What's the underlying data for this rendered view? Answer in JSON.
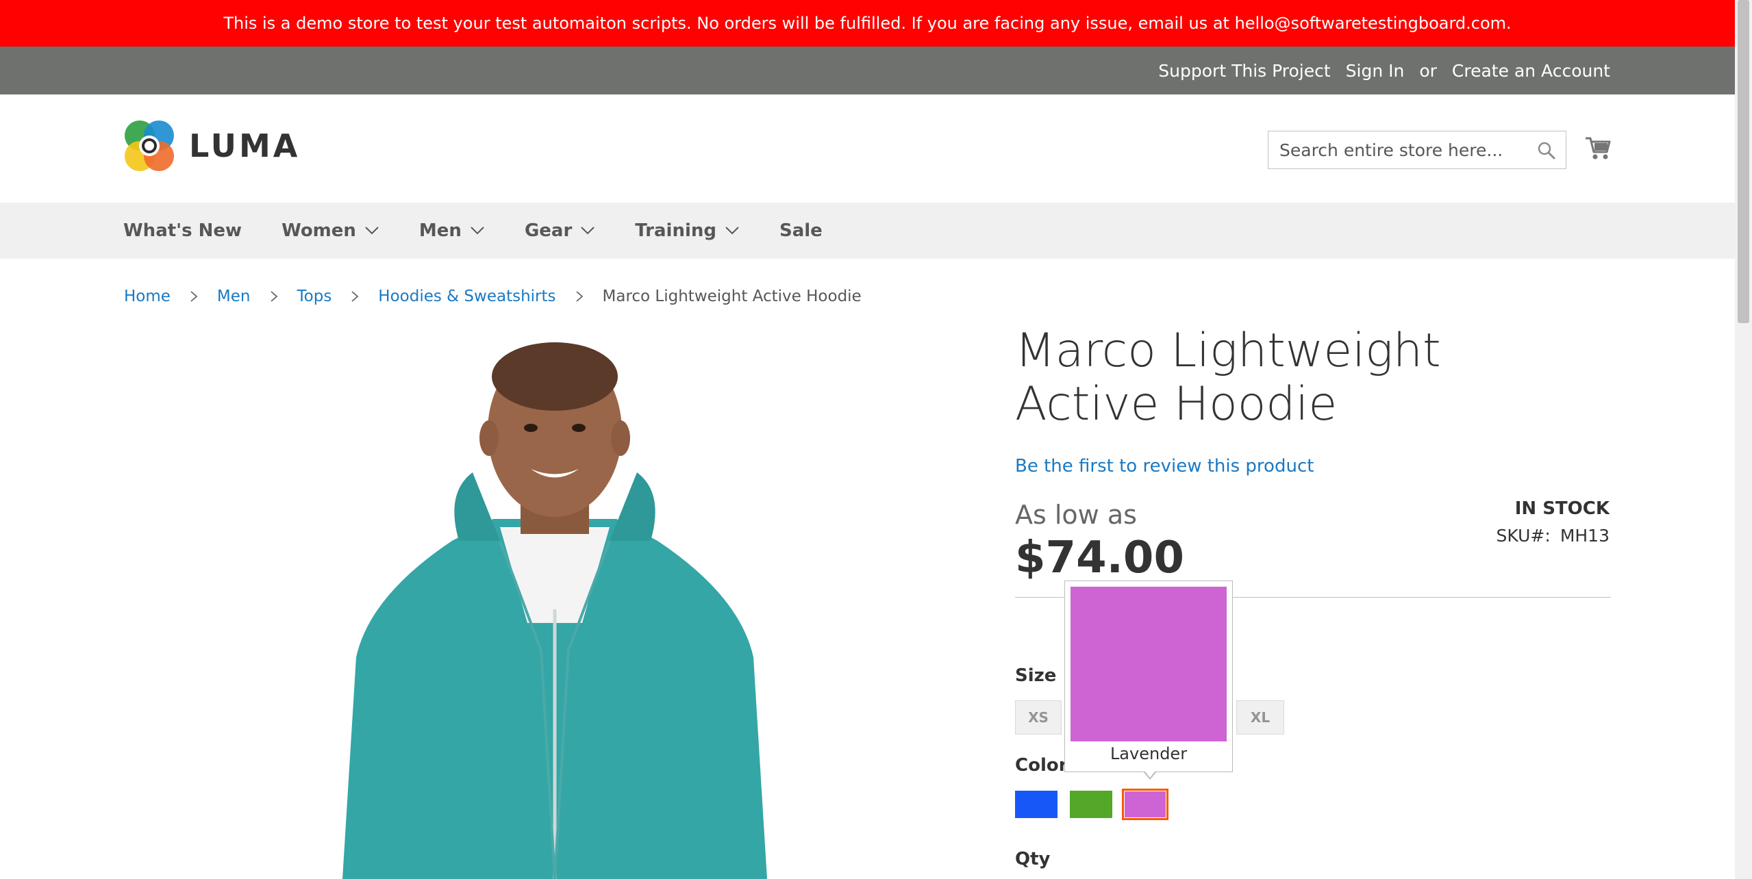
{
  "banner": {
    "text": "This is a demo store to test your test automaiton scripts. No orders will be fulfilled. If you are facing any issue, email us at hello@softwaretestingboard.com."
  },
  "top_links": {
    "support": "Support This Project",
    "sign_in": "Sign In",
    "or": "or",
    "create_account": "Create an Account"
  },
  "header": {
    "logo_text": "LUMA",
    "search_placeholder": "Search entire store here...",
    "icons": {
      "search": "search-icon",
      "cart": "cart-icon"
    }
  },
  "nav": {
    "items": [
      {
        "label": "What's New",
        "has_dropdown": false
      },
      {
        "label": "Women",
        "has_dropdown": true
      },
      {
        "label": "Men",
        "has_dropdown": true
      },
      {
        "label": "Gear",
        "has_dropdown": true
      },
      {
        "label": "Training",
        "has_dropdown": true
      },
      {
        "label": "Sale",
        "has_dropdown": false
      }
    ]
  },
  "breadcrumb": {
    "items": [
      "Home",
      "Men",
      "Tops",
      "Hoodies & Sweatshirts"
    ],
    "current": "Marco Lightweight Active Hoodie"
  },
  "product": {
    "title": "Marco Lightweight Active Hoodie",
    "review_link": "Be the first to review this product",
    "stock": "IN STOCK",
    "sku_label": "SKU#:",
    "sku_value": "MH13",
    "price_prefix": "As low as",
    "price": "$74.00",
    "size_label": "Size",
    "sizes": [
      "XS",
      "XL"
    ],
    "color_label": "Color",
    "colors": [
      {
        "name": "Blue",
        "hex": "#1857f7"
      },
      {
        "name": "Green",
        "hex": "#53a828"
      },
      {
        "name": "Lavender",
        "hex": "#ce64d4",
        "selected": true
      }
    ],
    "tooltip_label": "Lavender",
    "qty_label": "Qty"
  },
  "colors": {
    "banner": "#ff0101",
    "top_panel": "#6e716e",
    "nav_bg": "#f0f0f0",
    "link": "#1979c3",
    "hoodie": "#34a6a6"
  }
}
